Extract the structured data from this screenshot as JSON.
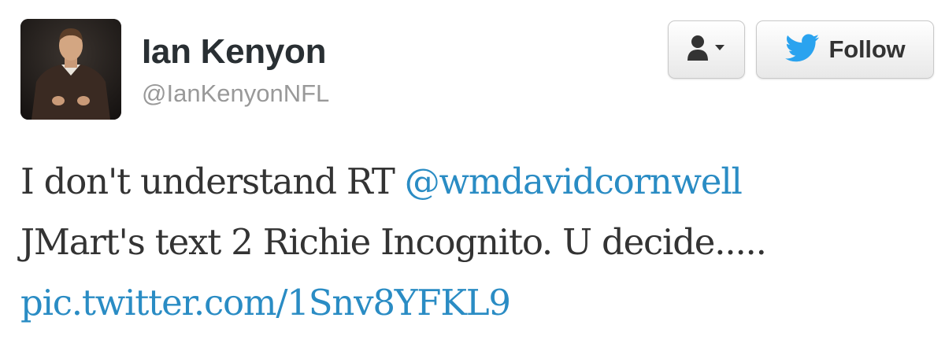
{
  "user": {
    "display_name": "Ian Kenyon",
    "handle": "@IanKenyonNFL",
    "avatar_icon": "profile-photo"
  },
  "actions": {
    "user_menu_icon": "person-dropdown-icon",
    "follow_icon": "twitter-bird-icon",
    "follow_label": "Follow"
  },
  "tweet": {
    "text_before_mention": "I don't understand RT ",
    "mention": "@wmdavidcornwell",
    "text_line2": "JMart's text 2 Richie Incognito. U decide.....",
    "pic_link": "pic.twitter.com/1Snv8YFKL9"
  },
  "colors": {
    "link": "#2a8cc4",
    "text": "#333333",
    "handle": "#999999",
    "bird": "#2aa3ef"
  }
}
